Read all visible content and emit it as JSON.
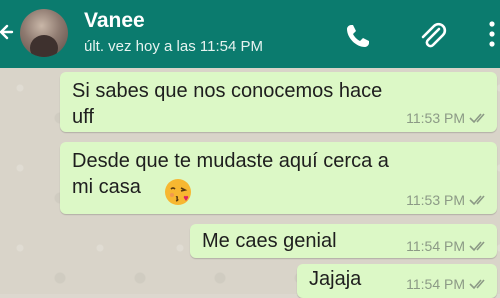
{
  "header": {
    "contact_name": "Vanee",
    "last_seen": "últ. vez hoy a las 11:54 PM",
    "back_icon": "arrow-left-icon",
    "icons": [
      "phone-icon",
      "paperclip-icon",
      "more-vert-icon"
    ],
    "color": "#0b7b6e"
  },
  "messages": [
    {
      "text": "Si sabes que nos conocemos hace\nuff",
      "time": "11:53 PM",
      "status": "read"
    },
    {
      "text": "Desde que te mudaste aquí  cerca a\nmi casa",
      "emoji": "kissing-face-emoji",
      "time": "11:53 PM",
      "status": "read"
    },
    {
      "text": "Me caes genial",
      "time": "11:54 PM",
      "status": "read"
    },
    {
      "text": "Jajaja",
      "time": "11:54 PM",
      "status": "read"
    }
  ],
  "colors": {
    "bubble_out": "#dcf8c6",
    "chat_bg": "#d9d4c9"
  }
}
